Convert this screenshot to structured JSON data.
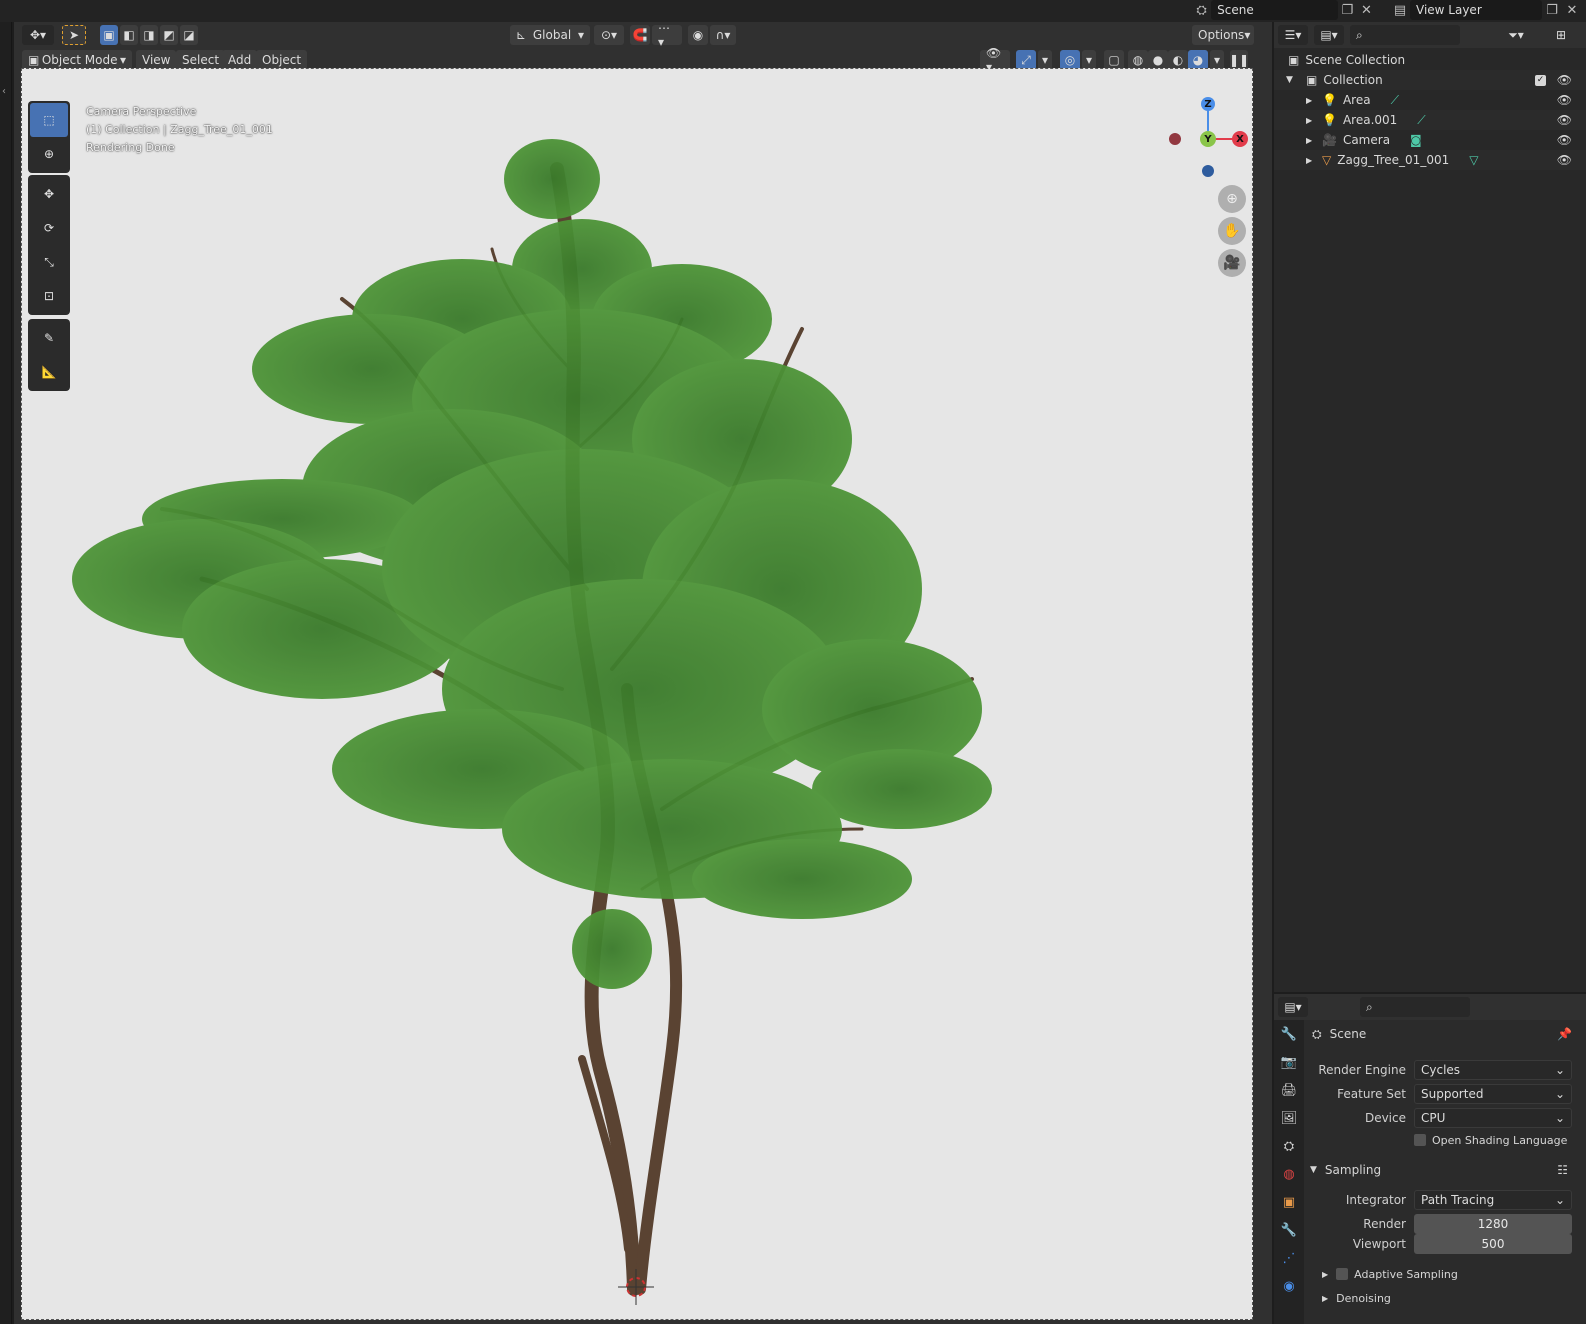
{
  "topbar": {
    "scene_label": "Scene",
    "view_layer_label": "View Layer"
  },
  "viewport": {
    "header": {
      "orientation": "Global",
      "options": "Options"
    },
    "menu": {
      "mode": "Object Mode",
      "view": "View",
      "select": "Select",
      "add": "Add",
      "object": "Object"
    },
    "overlay": {
      "line1": "Camera Perspective",
      "line2": "(1) Collection | Zagg_Tree_01_001",
      "line3": "Rendering Done"
    },
    "gizmo": {
      "z": "Z",
      "y": "Y",
      "x": "X"
    },
    "background_color": "#e6e6e6",
    "foliage_color": "#3f7d2e"
  },
  "outliner": {
    "root": "Scene Collection",
    "items": [
      {
        "label": "Collection",
        "indent": 1
      },
      {
        "label": "Area",
        "indent": 2
      },
      {
        "label": "Area.001",
        "indent": 2
      },
      {
        "label": "Camera",
        "indent": 2
      },
      {
        "label": "Zagg_Tree_01_001",
        "indent": 2
      }
    ]
  },
  "properties": {
    "context": "Scene",
    "render_engine_label": "Render Engine",
    "render_engine": "Cycles",
    "feature_set_label": "Feature Set",
    "feature_set": "Supported",
    "device_label": "Device",
    "device": "CPU",
    "osl_label": "Open Shading Language",
    "sampling_label": "Sampling",
    "integrator_label": "Integrator",
    "integrator": "Path Tracing",
    "render_label": "Render",
    "render_samples": "1280",
    "viewport_label": "Viewport",
    "viewport_samples": "500",
    "adaptive_label": "Adaptive Sampling",
    "denoising_label": "Denoising"
  }
}
